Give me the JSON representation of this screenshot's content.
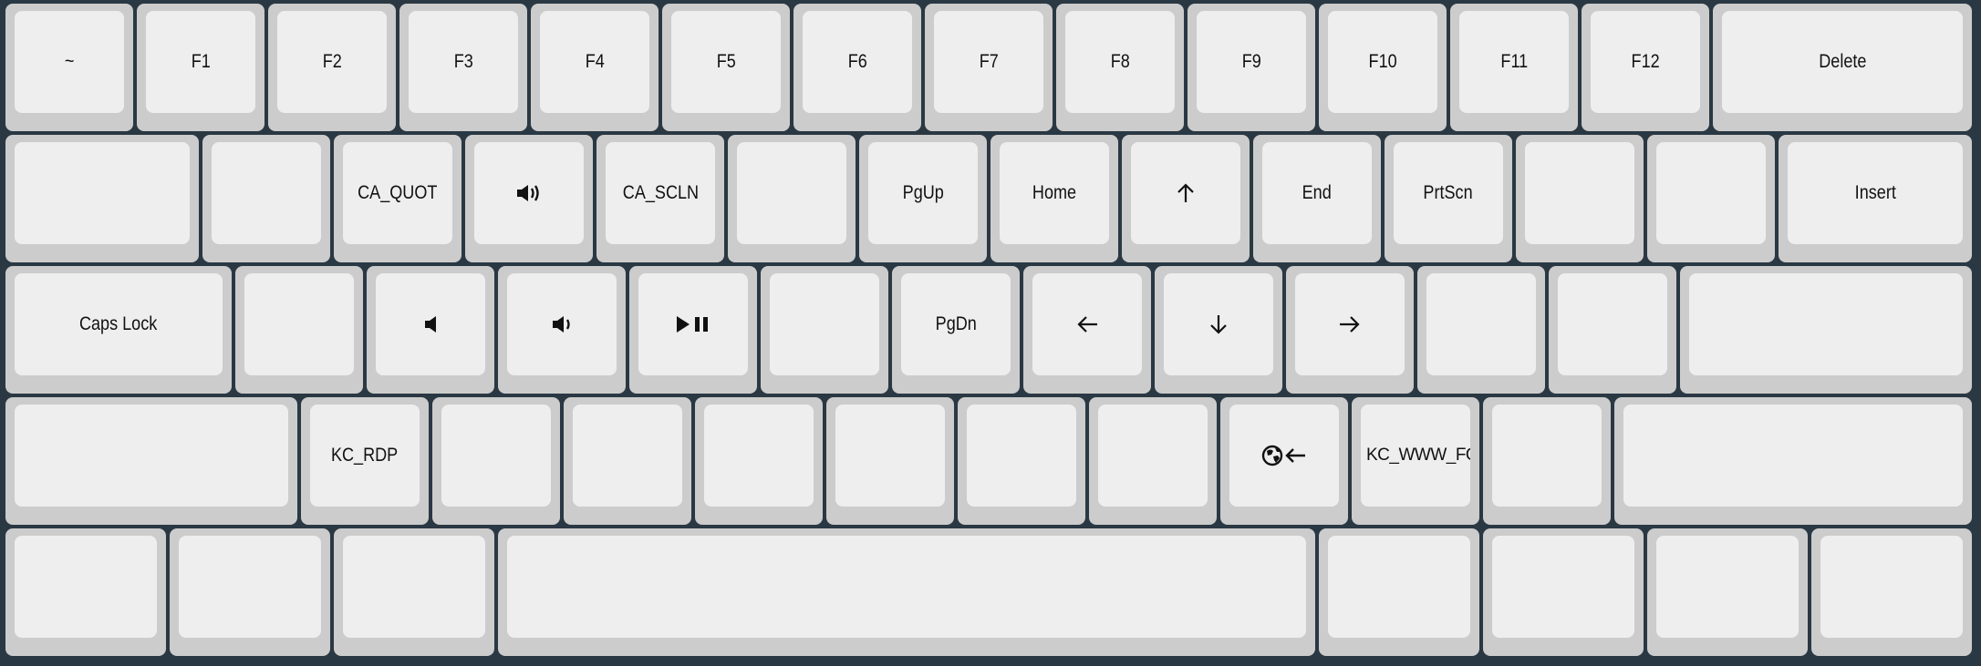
{
  "colors": {
    "background": "#2a3843",
    "key_border": "#cccccc",
    "key_top": "#eeeeee",
    "legend": "#111111"
  },
  "rows": [
    [
      {
        "label": "~"
      },
      {
        "label": "F1"
      },
      {
        "label": "F2"
      },
      {
        "label": "F3"
      },
      {
        "label": "F4"
      },
      {
        "label": "F5"
      },
      {
        "label": "F6"
      },
      {
        "label": "F7"
      },
      {
        "label": "F8"
      },
      {
        "label": "F9"
      },
      {
        "label": "F10"
      },
      {
        "label": "F11"
      },
      {
        "label": "F12"
      },
      {
        "label": "Delete"
      }
    ],
    [
      {
        "label": ""
      },
      {
        "label": ""
      },
      {
        "label": "CA_QUOT"
      },
      {
        "icon": "volume-up-icon"
      },
      {
        "label": "CA_SCLN"
      },
      {
        "label": ""
      },
      {
        "label": "PgUp"
      },
      {
        "label": "Home"
      },
      {
        "icon": "arrow-up-icon"
      },
      {
        "label": "End"
      },
      {
        "label": "PrtScn"
      },
      {
        "label": ""
      },
      {
        "label": ""
      },
      {
        "label": "Insert"
      }
    ],
    [
      {
        "label": "Caps Lock"
      },
      {
        "label": ""
      },
      {
        "icon": "mute-icon"
      },
      {
        "icon": "volume-down-icon"
      },
      {
        "icon": "play-pause-icon"
      },
      {
        "label": ""
      },
      {
        "label": "PgDn"
      },
      {
        "icon": "arrow-left-icon"
      },
      {
        "icon": "arrow-down-icon"
      },
      {
        "icon": "arrow-right-icon"
      },
      {
        "label": ""
      },
      {
        "label": ""
      },
      {
        "label": ""
      }
    ],
    [
      {
        "label": ""
      },
      {
        "label": "KC_RDP"
      },
      {
        "label": ""
      },
      {
        "label": ""
      },
      {
        "label": ""
      },
      {
        "label": ""
      },
      {
        "label": ""
      },
      {
        "label": ""
      },
      {
        "icon": "browser-back-icon"
      },
      {
        "label": "KC_WWW_FORWARD"
      },
      {
        "label": ""
      },
      {
        "label": ""
      }
    ],
    [
      {
        "label": ""
      },
      {
        "label": ""
      },
      {
        "label": ""
      },
      {
        "label": ""
      },
      {
        "label": ""
      },
      {
        "label": ""
      },
      {
        "label": ""
      },
      {
        "label": ""
      }
    ]
  ]
}
